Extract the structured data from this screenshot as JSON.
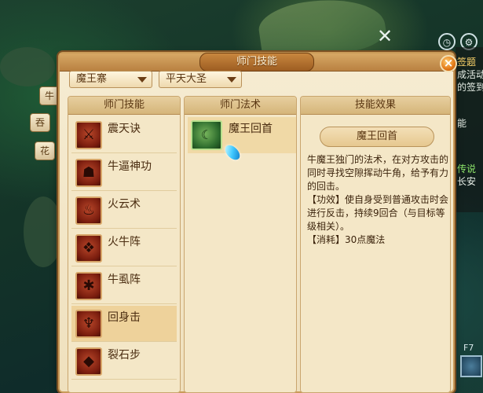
{
  "window": {
    "title": "师门技能"
  },
  "dropdowns": {
    "sect": "魔王寨",
    "subsect": "平天大圣"
  },
  "columns": {
    "skills_header": "师门技能",
    "spells_header": "师门法术",
    "effect_header": "技能效果"
  },
  "skills": [
    {
      "label": "震天诀",
      "icon": "thunder-claw-icon"
    },
    {
      "label": "牛逼神功",
      "icon": "demon-mask-icon"
    },
    {
      "label": "火云术",
      "icon": "fire-cloud-icon"
    },
    {
      "label": "火牛阵",
      "icon": "fire-bull-icon"
    },
    {
      "label": "牛虱阵",
      "icon": "bug-swarm-icon"
    },
    {
      "label": "回身击",
      "icon": "horned-mask-icon",
      "selected": true
    },
    {
      "label": "裂石步",
      "icon": "stone-step-icon"
    }
  ],
  "spells": [
    {
      "label": "魔王回首",
      "icon": "bull-horn-icon"
    }
  ],
  "effect": {
    "name": "魔王回首",
    "description": "牛魔王独门的法术，在对方攻击的同时寻找空隙挥动牛角，给予有力的回击。",
    "effect_line": "【功效】使自身受到普通攻击时会进行反击，持续9回合（与目标等级相关）。",
    "cost_line": "【消耗】30点魔法"
  },
  "hud": {
    "right_texts": [
      "签题",
      "成活动",
      "的签到",
      "能",
      "传说",
      "长安"
    ],
    "hotkey": "F7"
  },
  "side_tabs": [
    "牛",
    "吞",
    "花"
  ],
  "colors": {
    "panel_bg": "#f4e7c7",
    "accent": "#b98141",
    "close": "#e27817"
  }
}
